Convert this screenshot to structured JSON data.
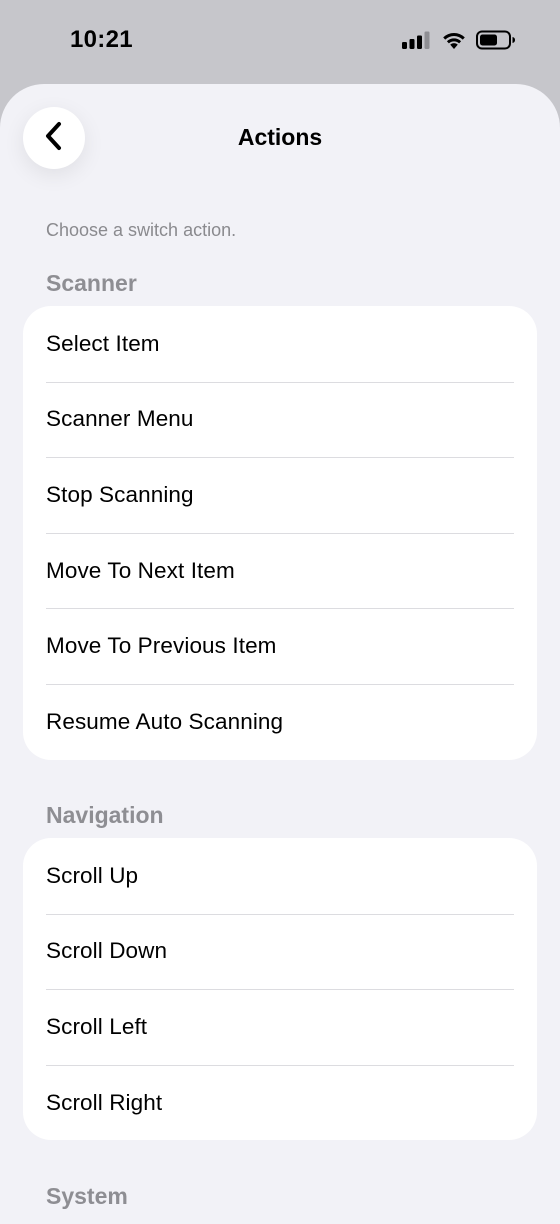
{
  "status_bar": {
    "time": "10:21",
    "icons": [
      "cellular-signal-icon",
      "wifi-icon",
      "battery-icon"
    ]
  },
  "nav": {
    "title": "Actions",
    "back_icon": "chevron-left-icon"
  },
  "subtitle": "Choose a switch action.",
  "sections": [
    {
      "header": "Scanner",
      "items": [
        {
          "label": "Select Item"
        },
        {
          "label": "Scanner Menu"
        },
        {
          "label": "Stop Scanning"
        },
        {
          "label": "Move To Next Item"
        },
        {
          "label": "Move To Previous Item"
        },
        {
          "label": "Resume Auto Scanning"
        }
      ]
    },
    {
      "header": "Navigation",
      "items": [
        {
          "label": "Scroll Up"
        },
        {
          "label": "Scroll Down"
        },
        {
          "label": "Scroll Left"
        },
        {
          "label": "Scroll Right"
        }
      ]
    },
    {
      "header": "System",
      "items": []
    }
  ]
}
